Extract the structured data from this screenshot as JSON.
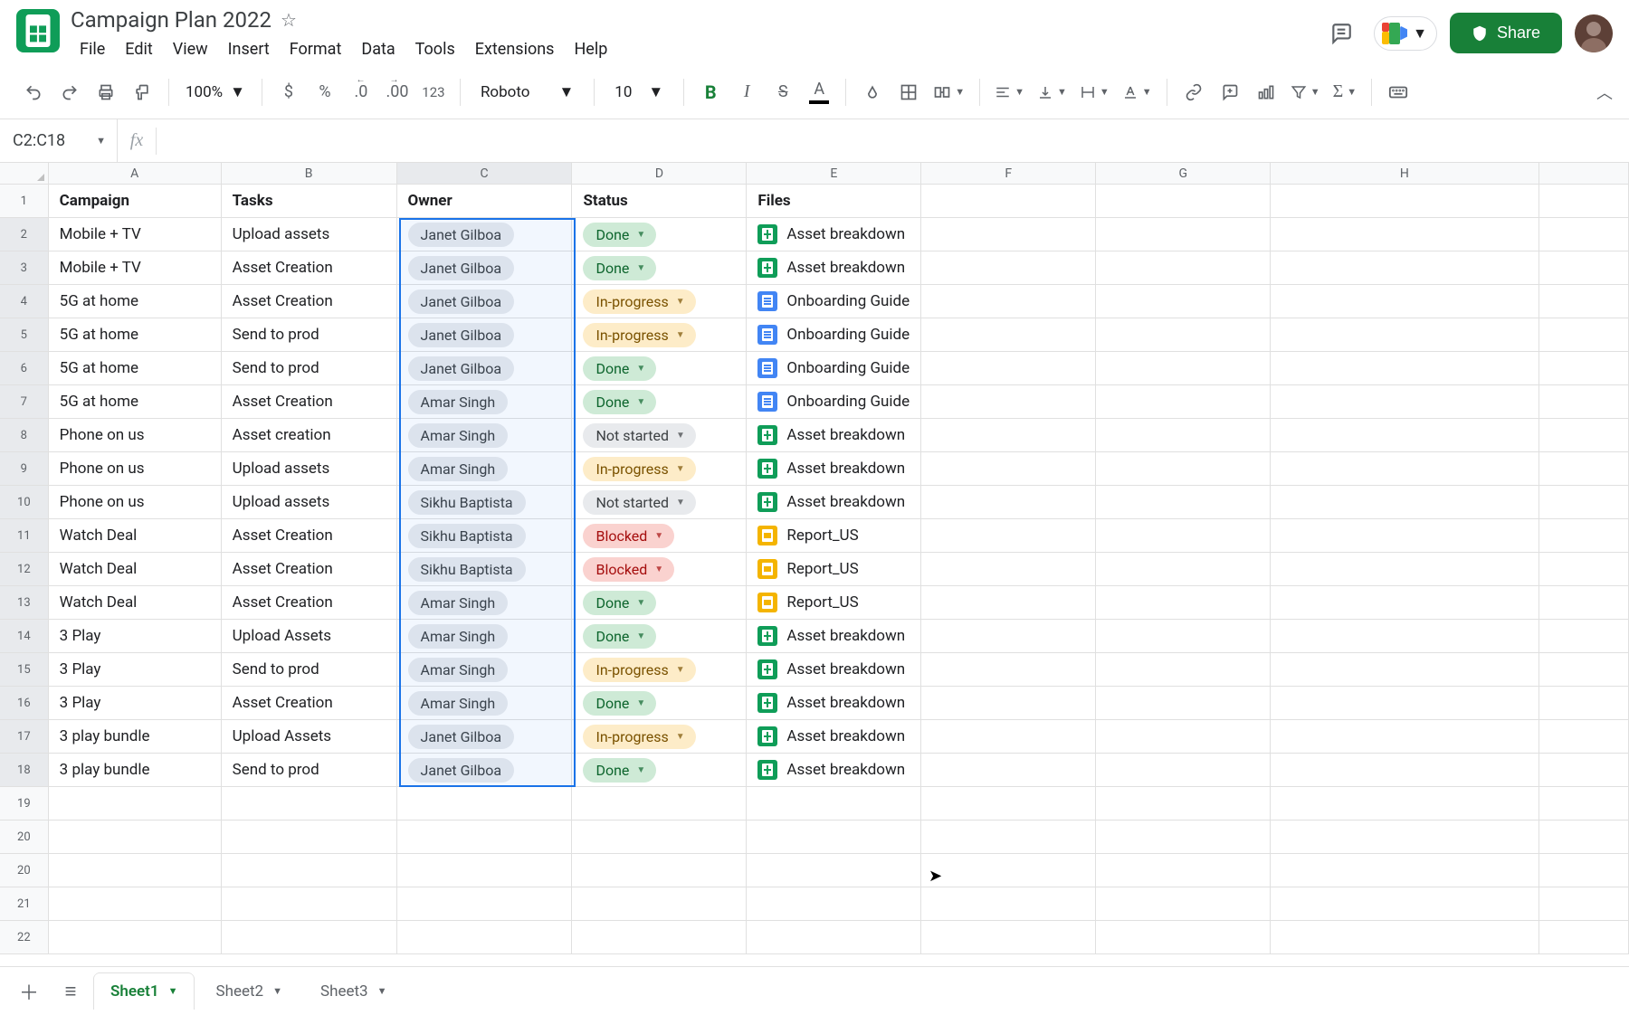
{
  "doc": {
    "title": "Campaign Plan 2022"
  },
  "menus": {
    "file": "File",
    "edit": "Edit",
    "view": "View",
    "insert": "Insert",
    "format": "Format",
    "data": "Data",
    "tools": "Tools",
    "extensions": "Extensions",
    "help": "Help"
  },
  "share": {
    "label": "Share"
  },
  "toolbar": {
    "zoom": "100%",
    "font": "Roboto",
    "size": "10",
    "currency": "$",
    "percent": "%",
    "dec_dec": ".0",
    "dec_inc": ".00",
    "num_fmt": "123"
  },
  "namebox": "C2:C18",
  "columns": [
    "A",
    "B",
    "C",
    "D",
    "E",
    "F",
    "G",
    "H",
    ""
  ],
  "headers": {
    "A": "Campaign",
    "B": "Tasks",
    "C": "Owner",
    "D": "Status",
    "E": "Files"
  },
  "status_labels": {
    "done": "Done",
    "prog": "In-progress",
    "nots": "Not started",
    "block": "Blocked"
  },
  "rows": [
    {
      "n": 1,
      "header": true
    },
    {
      "n": 2,
      "A": "Mobile + TV",
      "B": "Upload assets",
      "C": "Janet Gilboa",
      "D": "done",
      "E": {
        "t": "sheets",
        "name": "Asset breakdown"
      }
    },
    {
      "n": 3,
      "A": "Mobile + TV",
      "B": "Asset Creation",
      "C": "Janet Gilboa",
      "D": "done",
      "E": {
        "t": "sheets",
        "name": "Asset breakdown"
      }
    },
    {
      "n": 4,
      "A": "5G at home",
      "B": "Asset Creation",
      "C": "Janet Gilboa",
      "D": "prog",
      "E": {
        "t": "docs",
        "name": "Onboarding Guide"
      }
    },
    {
      "n": 5,
      "A": "5G at home",
      "B": "Send to prod",
      "C": "Janet Gilboa",
      "D": "prog",
      "E": {
        "t": "docs",
        "name": "Onboarding Guide"
      }
    },
    {
      "n": 6,
      "A": "5G at home",
      "B": "Send to prod",
      "C": "Janet Gilboa",
      "D": "done",
      "E": {
        "t": "docs",
        "name": "Onboarding Guide"
      }
    },
    {
      "n": 7,
      "A": "5G at home",
      "B": "Asset Creation",
      "C": "Amar Singh",
      "D": "done",
      "E": {
        "t": "docs",
        "name": "Onboarding Guide"
      }
    },
    {
      "n": 8,
      "A": "Phone on us",
      "B": "Asset creation",
      "C": "Amar Singh",
      "D": "nots",
      "E": {
        "t": "sheets",
        "name": "Asset breakdown"
      }
    },
    {
      "n": 9,
      "A": "Phone on us",
      "B": "Upload assets",
      "C": "Amar Singh",
      "D": "prog",
      "E": {
        "t": "sheets",
        "name": "Asset breakdown"
      }
    },
    {
      "n": 10,
      "A": "Phone on us",
      "B": "Upload assets",
      "C": "Sikhu Baptista",
      "D": "nots",
      "E": {
        "t": "sheets",
        "name": "Asset breakdown"
      }
    },
    {
      "n": 11,
      "A": "Watch Deal",
      "B": "Asset Creation",
      "C": "Sikhu Baptista",
      "D": "block",
      "E": {
        "t": "slides",
        "name": "Report_US"
      }
    },
    {
      "n": 12,
      "A": "Watch Deal",
      "B": "Asset Creation",
      "C": "Sikhu Baptista",
      "D": "block",
      "E": {
        "t": "slides",
        "name": "Report_US"
      }
    },
    {
      "n": 13,
      "A": "Watch Deal",
      "B": "Asset Creation",
      "C": "Amar Singh",
      "D": "done",
      "E": {
        "t": "slides",
        "name": "Report_US"
      }
    },
    {
      "n": 14,
      "A": "3 Play",
      "B": "Upload Assets",
      "C": "Amar Singh",
      "D": "done",
      "E": {
        "t": "sheets",
        "name": "Asset breakdown"
      }
    },
    {
      "n": 15,
      "A": "3 Play",
      "B": "Send to prod",
      "C": "Amar Singh",
      "D": "prog",
      "E": {
        "t": "sheets",
        "name": "Asset breakdown"
      }
    },
    {
      "n": 16,
      "A": "3 Play",
      "B": "Asset Creation",
      "C": "Amar Singh",
      "D": "done",
      "E": {
        "t": "sheets",
        "name": "Asset breakdown"
      }
    },
    {
      "n": 17,
      "A": "3 play bundle",
      "B": "Upload Assets",
      "C": "Janet Gilboa",
      "D": "prog",
      "E": {
        "t": "sheets",
        "name": "Asset breakdown"
      }
    },
    {
      "n": 18,
      "A": "3 play bundle",
      "B": "Send to prod",
      "C": "Janet Gilboa",
      "D": "done",
      "E": {
        "t": "sheets",
        "name": "Asset breakdown"
      }
    },
    {
      "n": 19
    },
    {
      "n": 20
    },
    {
      "n": 20
    },
    {
      "n": 21
    },
    {
      "n": 22
    }
  ],
  "tabs": {
    "s1": "Sheet1",
    "s2": "Sheet2",
    "s3": "Sheet3"
  }
}
